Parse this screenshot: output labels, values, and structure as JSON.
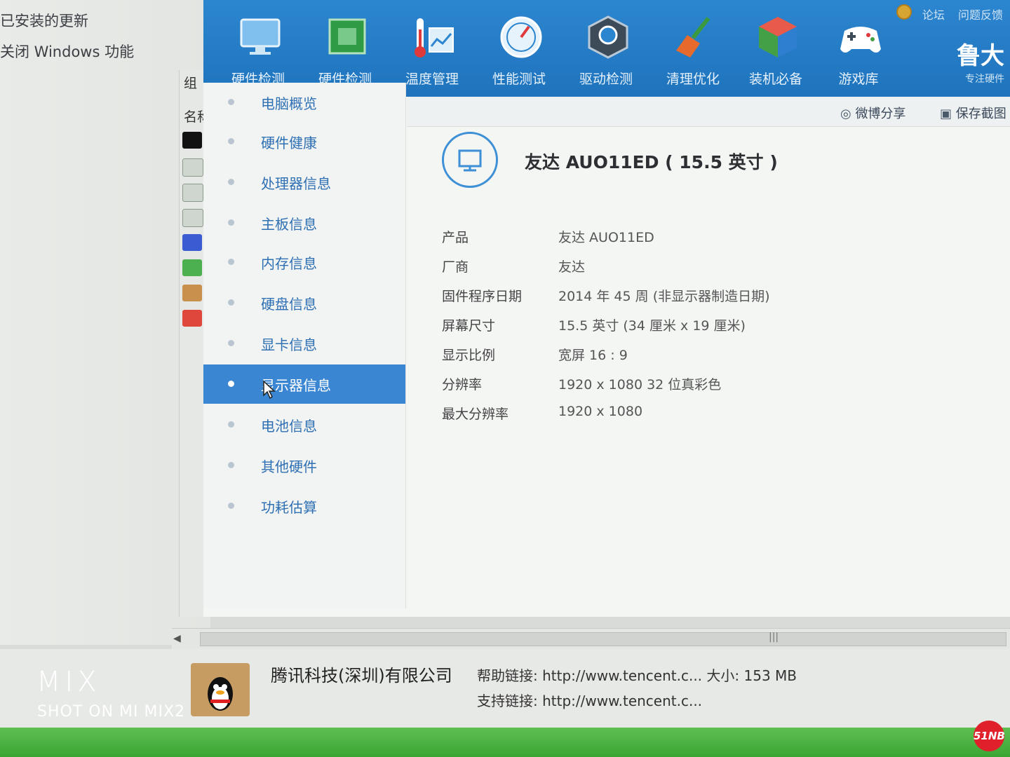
{
  "background_window": {
    "links": [
      "查看已安装的更新",
      "启用或关闭 Windows 功能"
    ],
    "link_visible": [
      "已安装的更新",
      "关闭 Windows 功能"
    ],
    "organize_partial": "组",
    "name_header_partial": "名称"
  },
  "app": {
    "toolbar": [
      {
        "label": "硬件检测",
        "icon": "monitor-icon"
      },
      {
        "label": "硬件检测",
        "icon": "chip-icon"
      },
      {
        "label": "温度管理",
        "icon": "thermometer-icon"
      },
      {
        "label": "性能测试",
        "icon": "speedometer-icon"
      },
      {
        "label": "驱动检测",
        "icon": "driver-chip-icon"
      },
      {
        "label": "清理优化",
        "icon": "broom-icon"
      },
      {
        "label": "装机必备",
        "icon": "cube-icon"
      },
      {
        "label": "游戏库",
        "icon": "gamepad-icon"
      }
    ],
    "top_links": [
      "论坛",
      "问题反馈"
    ],
    "brand_title": "鲁大",
    "brand_sub": "专注硬件",
    "actions": {
      "weibo_share": "微博分享",
      "save_screenshot": "保存截图"
    },
    "sidebar": [
      {
        "label": "电脑概览",
        "active": false
      },
      {
        "label": "硬件健康",
        "active": false
      },
      {
        "label": "处理器信息",
        "active": false
      },
      {
        "label": "主板信息",
        "active": false
      },
      {
        "label": "内存信息",
        "active": false
      },
      {
        "label": "硬盘信息",
        "active": false
      },
      {
        "label": "显卡信息",
        "active": false
      },
      {
        "label": "显示器信息",
        "active": true
      },
      {
        "label": "电池信息",
        "active": false
      },
      {
        "label": "其他硬件",
        "active": false
      },
      {
        "label": "功耗估算",
        "active": false
      }
    ],
    "monitor_title": "友达 AUO11ED ( 15.5 英寸 )",
    "info": [
      {
        "key": "产品",
        "value": "友达 AUO11ED"
      },
      {
        "key": "厂商",
        "value": "友达"
      },
      {
        "key": "固件程序日期",
        "value": "2014 年 45 周 (非显示器制造日期)"
      },
      {
        "key": "屏幕尺寸",
        "value": "15.5 英寸 (34 厘米 x 19 厘米)"
      },
      {
        "key": "显示比例",
        "value": "宽屏 16 : 9"
      },
      {
        "key": "分辨率",
        "value": "1920 x 1080 32 位真彩色"
      },
      {
        "key": "最大分辨率",
        "value": "1920 x 1080"
      }
    ]
  },
  "details_pane": {
    "publisher": "腾讯科技(深圳)有限公司",
    "help_link_label": "帮助链接:",
    "help_link": "http://www.tencent.c...",
    "size_label": "大小:",
    "size": "153 MB",
    "support_link_label": "支持链接:",
    "support_link": "http://www.tencent.c..."
  },
  "watermark": {
    "brand": "MIX",
    "shot": "SHOT ON MI MIX2",
    "site_logo": "51NB"
  },
  "colors": {
    "app_header": "#2c86cf",
    "active_item": "#3a86d2",
    "taskbar": "#4cb342"
  }
}
